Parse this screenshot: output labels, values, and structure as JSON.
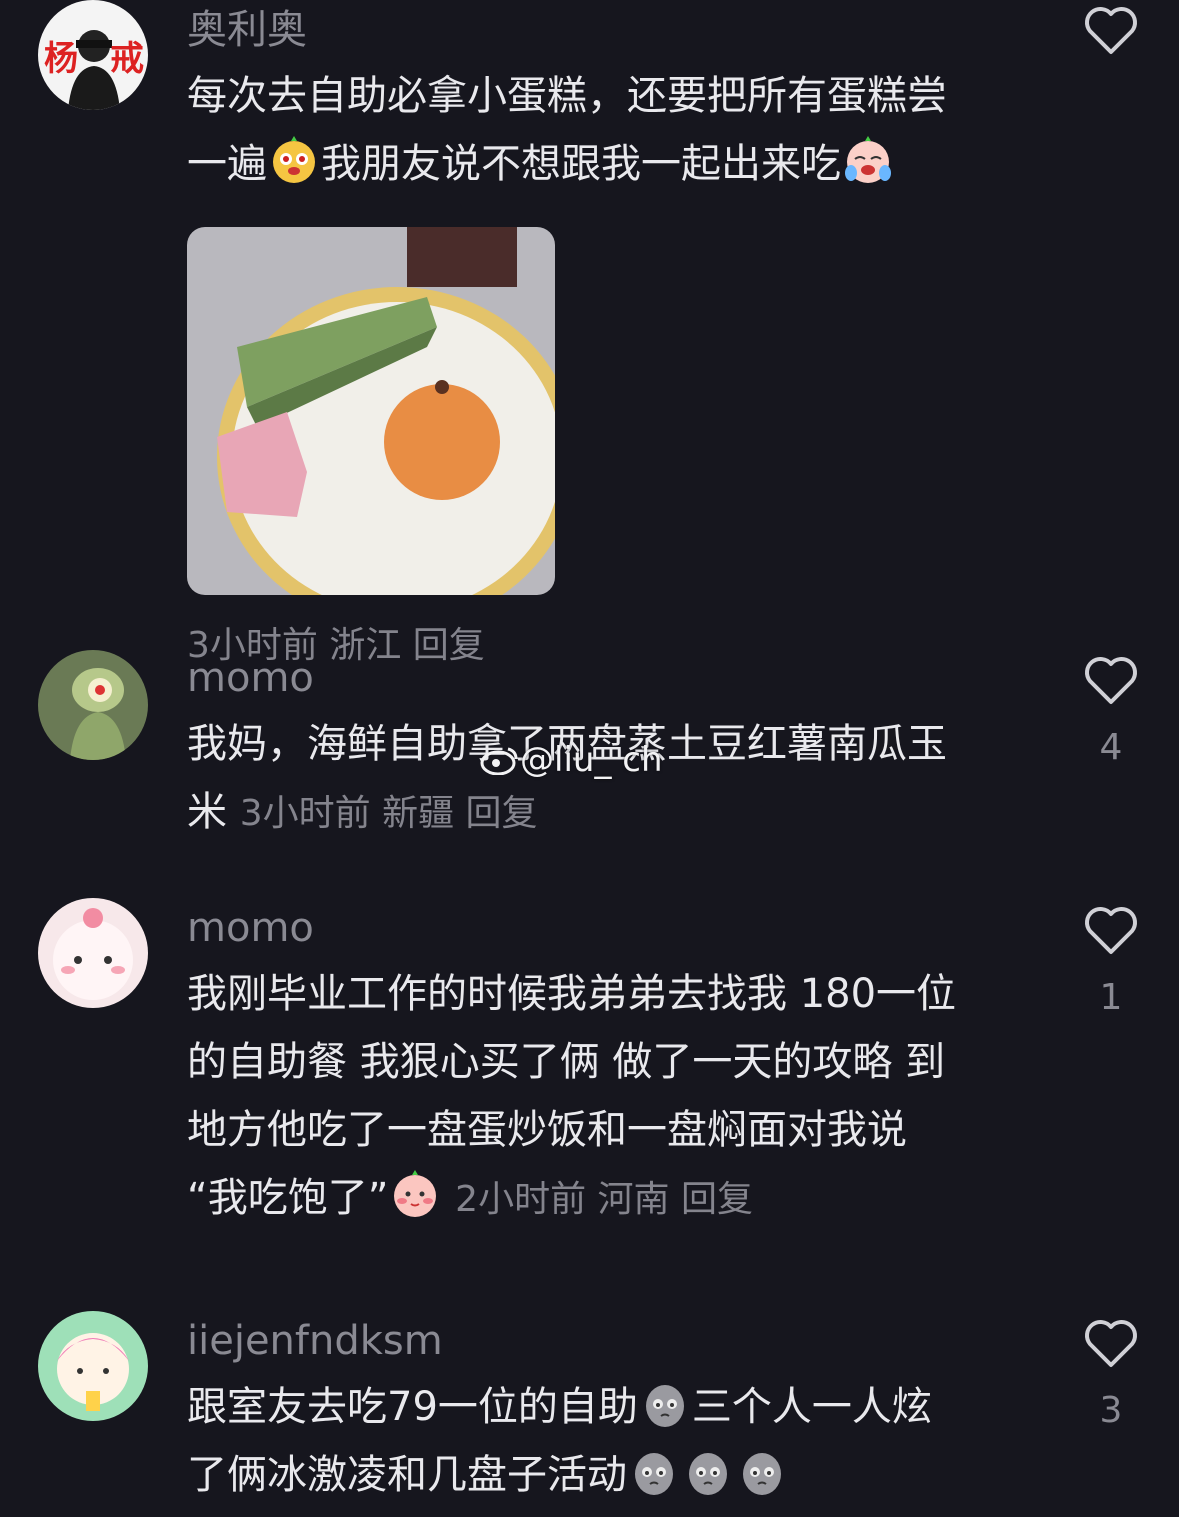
{
  "comments": [
    {
      "username": "奥利奥",
      "text_lines": [
        "每次去自助必拿小蛋糕，还要把所有蛋糕尝",
        "一遍",
        "我朋友说不想跟我一起出来吃"
      ],
      "meta": "3小时前 浙江 回复",
      "likes": ""
    },
    {
      "username": "momo",
      "text_lines": [
        "我妈，海鲜自助拿了两盘蒸土豆红薯南瓜玉",
        "米"
      ],
      "meta": "3小时前 新疆 回复",
      "likes": "4"
    },
    {
      "username": "momo",
      "text_lines": [
        "我刚毕业工作的时候我弟弟去找我 180一位",
        "的自助餐 我狠心买了俩 做了一天的攻略 到",
        "地方他吃了一盘蛋炒饭和一盘焖面对我说",
        "“我吃饱了”"
      ],
      "meta": "2小时前 河南 回复",
      "likes": "1"
    },
    {
      "username": "iiejenfndksm",
      "text_lines": [
        "跟室友去吃79一位的自助",
        "三个人一人炫",
        "了俩冰激凌和几盘子活动"
      ],
      "meta": "",
      "likes": "3"
    }
  ],
  "watermark": "@liu_      ch",
  "colors": {
    "background": "#16161e",
    "text": "#e9e9ed",
    "muted": "#8a8a93"
  }
}
